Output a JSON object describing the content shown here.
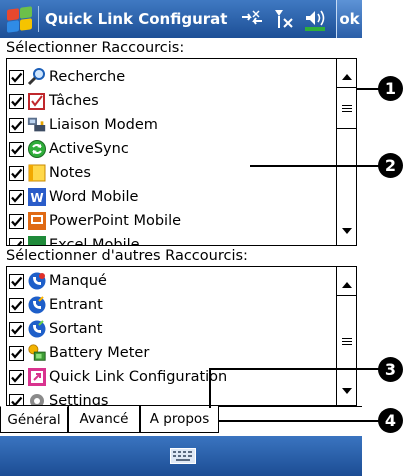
{
  "titlebar": {
    "title": "Quick Link Configurat",
    "ok_label": "ok"
  },
  "sections": {
    "primary_label": "Sélectionner Raccourcis:",
    "secondary_label": "Sélectionner d'autres Raccourcis:"
  },
  "primary_items": [
    {
      "label": "Recherche",
      "checked": true,
      "icon": "search-icon"
    },
    {
      "label": "Tâches",
      "checked": true,
      "icon": "tasks-icon"
    },
    {
      "label": "Liaison Modem",
      "checked": true,
      "icon": "modem-link-icon"
    },
    {
      "label": "ActiveSync",
      "checked": true,
      "icon": "activesync-icon"
    },
    {
      "label": "Notes",
      "checked": true,
      "icon": "notes-icon"
    },
    {
      "label": "Word Mobile",
      "checked": true,
      "icon": "word-icon"
    },
    {
      "label": "PowerPoint Mobile",
      "checked": true,
      "icon": "powerpoint-icon"
    },
    {
      "label": "Excel Mobile",
      "checked": true,
      "icon": "excel-icon"
    }
  ],
  "secondary_items": [
    {
      "label": "Manqué",
      "checked": true,
      "icon": "missed-call-icon"
    },
    {
      "label": "Entrant",
      "checked": true,
      "icon": "incoming-call-icon"
    },
    {
      "label": "Sortant",
      "checked": true,
      "icon": "outgoing-call-icon"
    },
    {
      "label": "Battery Meter",
      "checked": true,
      "icon": "battery-meter-icon"
    },
    {
      "label": "Quick Link Configuration",
      "checked": true,
      "icon": "quick-link-icon"
    },
    {
      "label": "Settings",
      "checked": true,
      "icon": "settings-icon"
    }
  ],
  "tabs": [
    {
      "label": "Général",
      "active": true
    },
    {
      "label": "Avancé",
      "active": false
    },
    {
      "label": "A propos",
      "active": false
    }
  ],
  "callouts": [
    "1",
    "2",
    "3",
    "4"
  ],
  "colors": {
    "titlebar": "#1d4f96",
    "accent_green": "#2fae3a"
  }
}
